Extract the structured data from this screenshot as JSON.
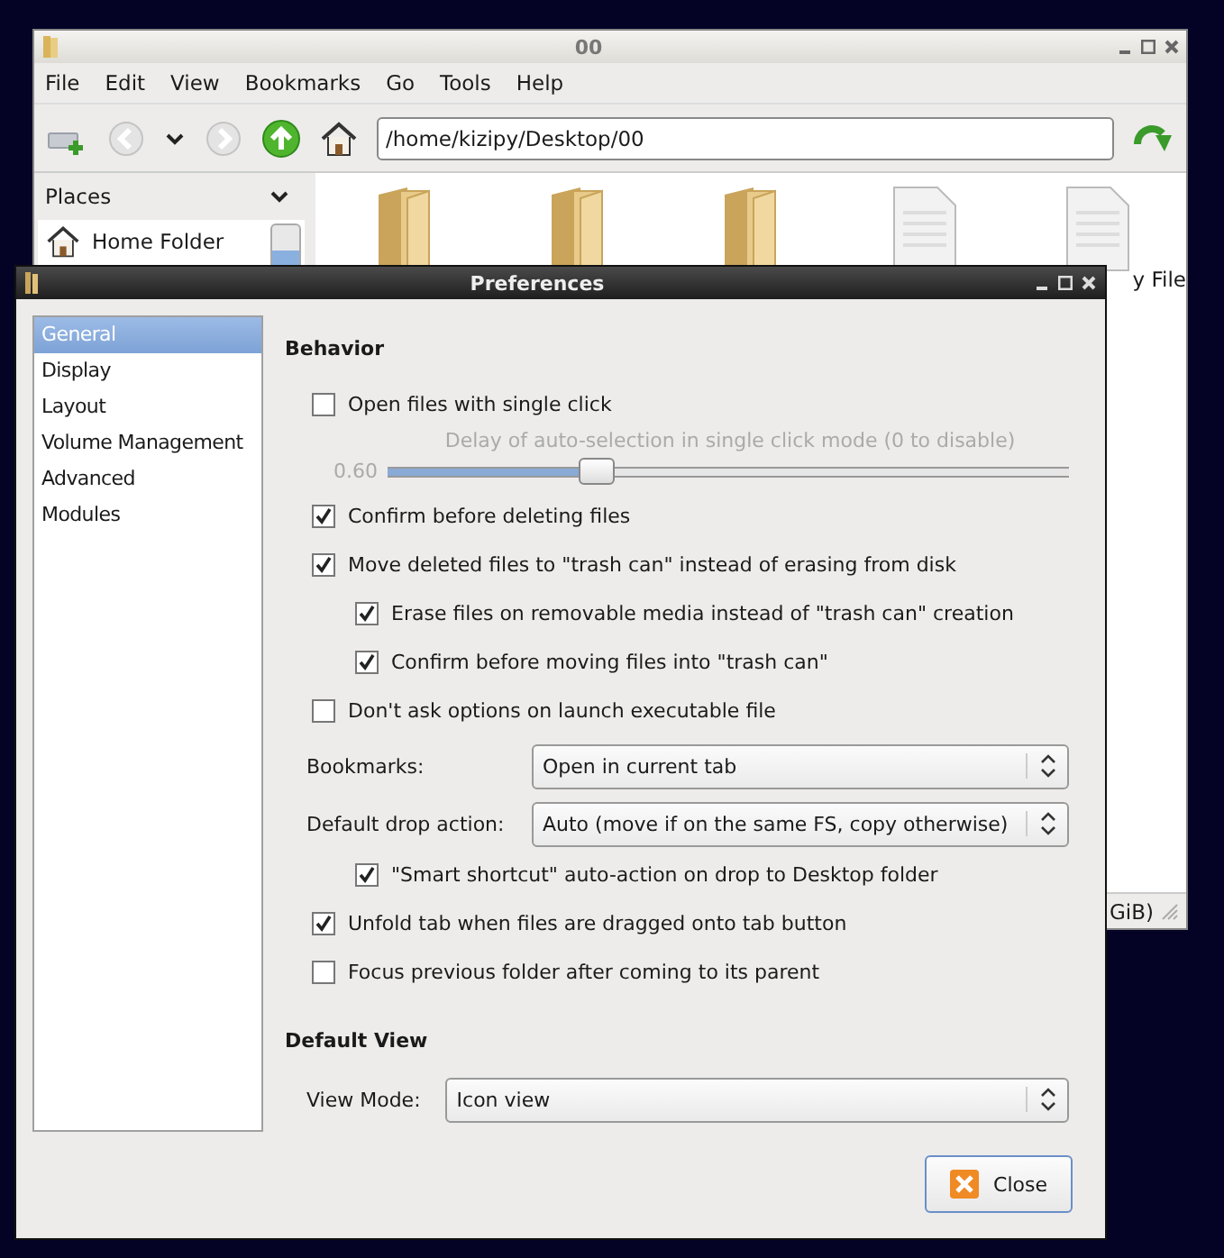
{
  "file_manager": {
    "title": "00",
    "menu": [
      "File",
      "Edit",
      "View",
      "Bookmarks",
      "Go",
      "Tools",
      "Help"
    ],
    "location": "/home/kizipy/Desktop/00",
    "places_title": "Places",
    "places": [
      {
        "label": "Home Folder"
      }
    ],
    "items": [
      {
        "kind": "folder"
      },
      {
        "kind": "folder"
      },
      {
        "kind": "folder"
      },
      {
        "kind": "document"
      },
      {
        "kind": "document"
      }
    ],
    "item_label": "y File",
    "status_text": "GiB)"
  },
  "dialog": {
    "title": "Preferences",
    "categories": [
      {
        "label": "General",
        "selected": true
      },
      {
        "label": "Display",
        "selected": false
      },
      {
        "label": "Layout",
        "selected": false
      },
      {
        "label": "Volume Management",
        "selected": false
      },
      {
        "label": "Advanced",
        "selected": false
      },
      {
        "label": "Modules",
        "selected": false
      }
    ],
    "sections": [
      {
        "title": "Behavior",
        "rows": [
          {
            "kind": "check",
            "label": "Open files with single click",
            "checked": false
          },
          {
            "kind": "slider",
            "caption": "Delay of auto-selection in single click mode (0 to disable)",
            "reading": "0.60",
            "level": 0.31,
            "disabled": true
          },
          {
            "kind": "check",
            "label": "Confirm before deleting files",
            "checked": true
          },
          {
            "kind": "check",
            "label": "Move deleted files to \"trash can\" instead of erasing from disk",
            "checked": true,
            "children": [
              {
                "kind": "check",
                "label": "Erase files on removable media instead of \"trash can\" creation",
                "checked": true
              },
              {
                "kind": "check",
                "label": "Confirm before moving files into \"trash can\"",
                "checked": true
              }
            ]
          },
          {
            "kind": "check",
            "label": "Don't ask options on launch executable file",
            "checked": false
          },
          {
            "kind": "select",
            "label": "Bookmarks:",
            "value": "Open in current tab"
          },
          {
            "kind": "select",
            "label": "Default drop action:",
            "value": "Auto (move if on the same FS, copy otherwise)",
            "children": [
              {
                "kind": "check",
                "label": "\"Smart shortcut\" auto-action on drop to Desktop folder",
                "checked": true
              }
            ]
          },
          {
            "kind": "check",
            "label": "Unfold tab when files are dragged onto tab button",
            "checked": true
          },
          {
            "kind": "check",
            "label": "Focus previous folder after coming to its parent",
            "checked": false
          }
        ]
      },
      {
        "title": "Default View",
        "rows": [
          {
            "kind": "select",
            "label": "View Mode:",
            "value": "Icon view"
          }
        ]
      }
    ],
    "close_button": "Close"
  }
}
